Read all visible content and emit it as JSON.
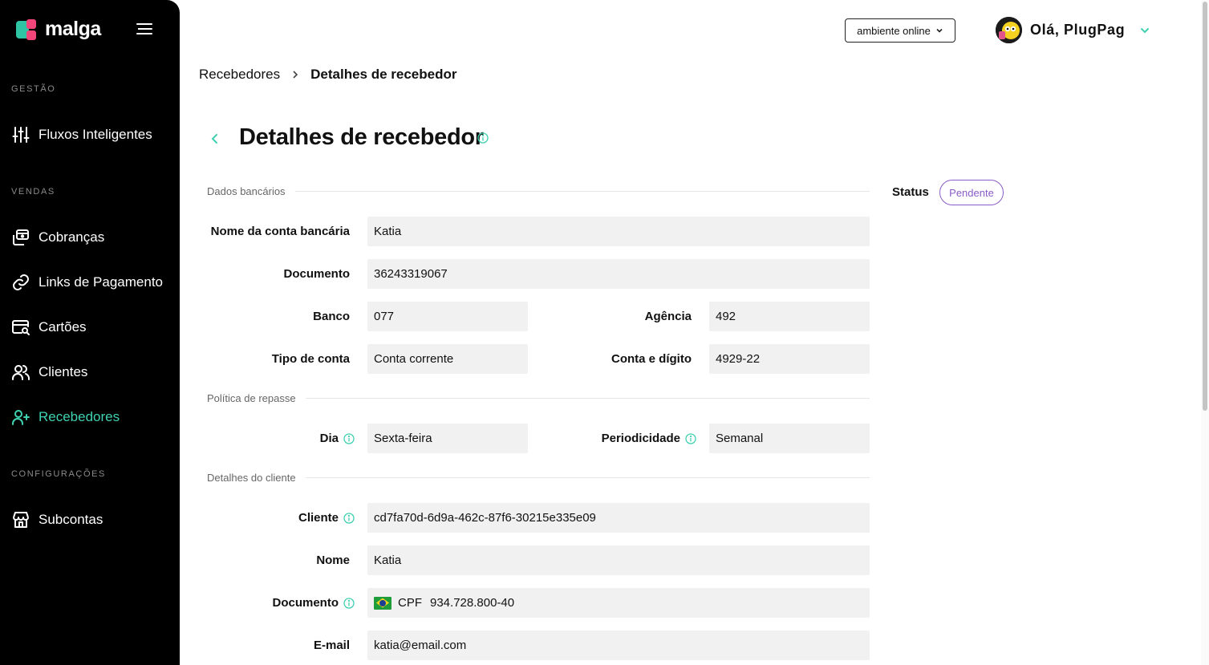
{
  "brand": {
    "name": "malga"
  },
  "sidebar": {
    "sections": [
      {
        "title": "GESTÃO"
      },
      {
        "title": "VENDAS"
      },
      {
        "title": "CONFIGURAÇÕES"
      }
    ],
    "items": [
      {
        "label": "Fluxos Inteligentes",
        "icon": "sliders-icon"
      },
      {
        "label": "Cobranças",
        "icon": "charges-icon"
      },
      {
        "label": "Links de Pagamento",
        "icon": "link-icon"
      },
      {
        "label": "Cartões",
        "icon": "card-search-icon"
      },
      {
        "label": "Clientes",
        "icon": "users-icon"
      },
      {
        "label": "Recebedores",
        "icon": "user-plus-icon",
        "active": true
      },
      {
        "label": "Subcontas",
        "icon": "store-icon"
      }
    ],
    "active_color": "#3fd1b0"
  },
  "header": {
    "environment": "ambiente online",
    "greeting": "Olá, PlugPag"
  },
  "breadcrumb": {
    "parent": "Recebedores",
    "current": "Detalhes de recebedor"
  },
  "page": {
    "title": "Detalhes de recebedor"
  },
  "status": {
    "label": "Status",
    "value": "Pendente",
    "color": "#8a5cc8"
  },
  "bank": {
    "section_title": "Dados bancários",
    "account_name_label": "Nome da conta bancária",
    "account_name": "Katia",
    "document_label": "Documento",
    "document": "36243319067",
    "bank_label": "Banco",
    "bank": "077",
    "agency_label": "Agência",
    "agency": "492",
    "account_type_label": "Tipo de conta",
    "account_type": "Conta corrente",
    "account_number_label": "Conta e dígito",
    "account_number": "4929-22"
  },
  "transfer": {
    "section_title": "Política de repasse",
    "day_label": "Dia",
    "day": "Sexta-feira",
    "period_label": "Periodicidade",
    "period": "Semanal"
  },
  "customer": {
    "section_title": "Detalhes do cliente",
    "client_label": "Cliente",
    "client_id": "cd7fa70d-6d9a-462c-87f6-30215e335e09",
    "name_label": "Nome",
    "name": "Katia",
    "document_label": "Documento",
    "document_type": "CPF",
    "document": "934.728.800-40",
    "email_label": "E-mail",
    "email": "katia@email.com"
  }
}
